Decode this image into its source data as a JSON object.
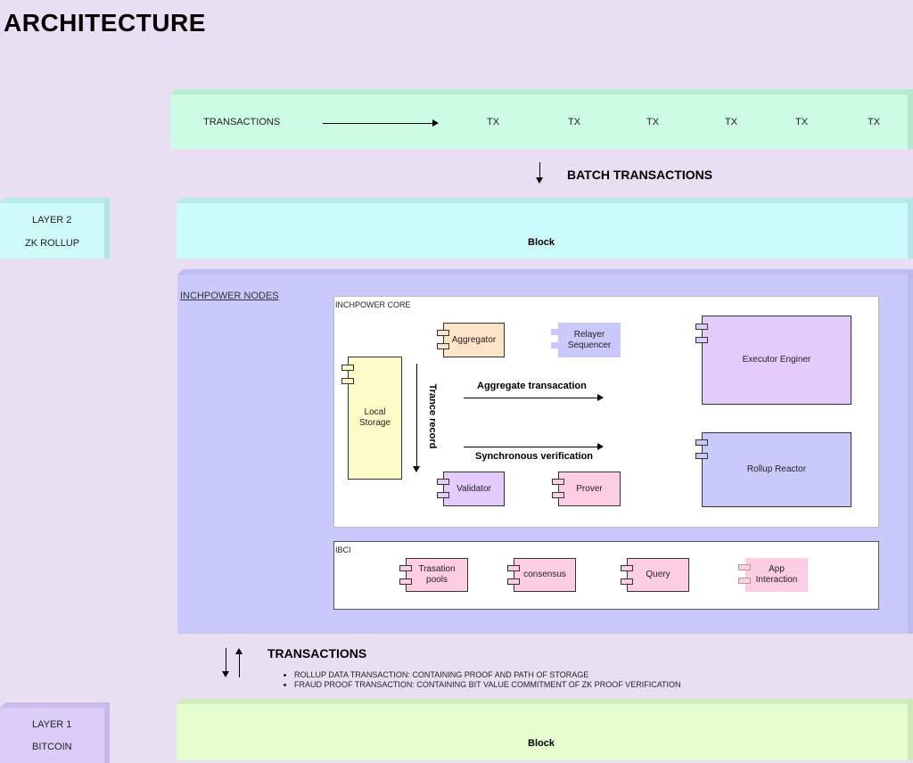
{
  "title": "ARCHITECTURE",
  "transactions_row": {
    "label": "TRANSACTIONS",
    "tx_items": [
      "TX",
      "TX",
      "TX",
      "TX",
      "TX",
      "TX"
    ]
  },
  "batch_label": "BATCH TRANSACTIONS",
  "layer2": {
    "line1": "LAYER 2",
    "line2": "ZK ROLLUP",
    "block_label": "Block"
  },
  "nodes": {
    "label": "INCHPOWER NODES",
    "core": {
      "label": "INCHPOWER CORE",
      "components": {
        "aggregator": "Aggregator",
        "relayer": "Relayer Sequencer",
        "executor": "Executor Enginer",
        "local_storage": "Local Storage",
        "validator": "Validator",
        "prover": "Prover",
        "rollup_reactor": "Rollup Reactor"
      },
      "trance_record": "Trance record",
      "aggregate_label": "Aggregate  transacation",
      "sync_label": "Synchronous verification"
    },
    "ibci": {
      "label": "IBCI",
      "components": {
        "pools": "Trasation pools",
        "consensus": "consensus",
        "query": "Query",
        "app": "App Interaction"
      }
    }
  },
  "l1_transactions": {
    "title": "TRANSACTIONS",
    "notes": [
      "ROLLUP DATA TRANSACTION: CONTAINING PROOF AND PATH OF STORAGE",
      "FRAUD PROOF TRANSACTION: CONTAINING BIT VALUE COMMITMENT OF ZK PROOF VERIFICATION"
    ]
  },
  "layer1": {
    "line1": "LAYER 1",
    "line2": "BITCOIN",
    "block_label": "Block"
  },
  "colors": {
    "background": "#e8e0f2",
    "tx_strip": "#ccfce3",
    "layer2": "#ccfbfb",
    "nodes": "#c9c9fb",
    "layer1_block": "#e6fdd0",
    "layer1_side": "#dccdf8",
    "aggregator": "#fde3c8",
    "relayer": "#c9c9fb",
    "executor": "#e3ccfb",
    "local_storage": "#fdfcc8",
    "validator": "#e3ccfb",
    "prover": "#fdcde3",
    "rollup_reactor": "#c9c9fb",
    "ibci_components": "#fdcde3"
  }
}
